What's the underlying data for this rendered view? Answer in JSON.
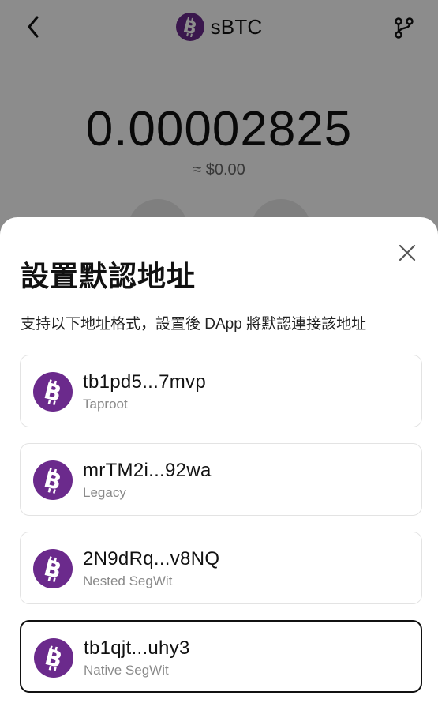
{
  "header": {
    "title": "sBTC",
    "coin_icon": "bitcoin-icon",
    "back_icon": "chevron-left-icon",
    "branch_icon": "git-branch-icon"
  },
  "balance": {
    "amount": "0.00002825",
    "fiat": "≈ $0.00"
  },
  "sheet": {
    "title": "設置默認地址",
    "description": "支持以下地址格式，設置後 DApp 將默認連接該地址",
    "close_icon": "close-icon",
    "addresses": [
      {
        "address": "tb1pd5...7mvp",
        "type": "Taproot",
        "selected": false
      },
      {
        "address": "mrTM2i...92wa",
        "type": "Legacy",
        "selected": false
      },
      {
        "address": "2N9dRq...v8NQ",
        "type": "Nested SegWit",
        "selected": false
      },
      {
        "address": "tb1qjt...uhy3",
        "type": "Native SegWit",
        "selected": true
      }
    ]
  },
  "colors": {
    "coin": "#6b2a8c",
    "overlay": "rgba(0,0,0,0.45)",
    "selected_border": "#111111",
    "card_border": "#e3e3e3"
  }
}
